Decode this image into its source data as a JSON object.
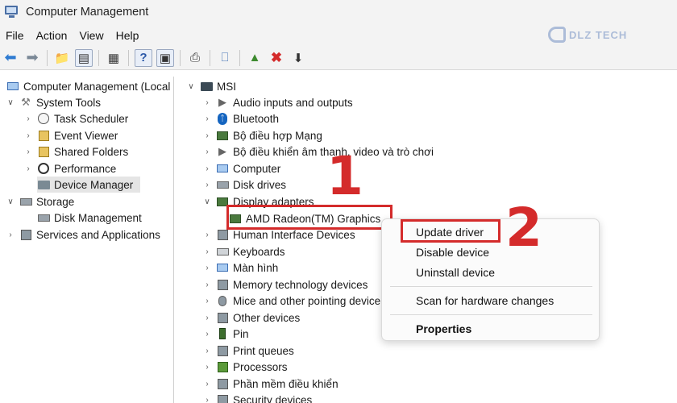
{
  "window": {
    "title": "Computer Management"
  },
  "watermark": {
    "text": "DLZ TECH"
  },
  "menubar": {
    "items": [
      "File",
      "Action",
      "View",
      "Help"
    ]
  },
  "left_tree": {
    "root": "Computer Management (Local",
    "system_tools": "System Tools",
    "task_scheduler": "Task Scheduler",
    "event_viewer": "Event Viewer",
    "shared_folders": "Shared Folders",
    "performance": "Performance",
    "device_manager": "Device Manager",
    "storage": "Storage",
    "disk_management": "Disk Management",
    "services_and_applications": "Services and Applications"
  },
  "device_tree": {
    "root": "MSI",
    "audio": "Audio inputs and outputs",
    "bluetooth": "Bluetooth",
    "network": "Bộ điều hợp Mạng",
    "sound": "Bộ điều khiển âm thanh, video và trò chơi",
    "computer": "Computer",
    "disk_drives": "Disk drives",
    "display_adapters": "Display adapters",
    "amd_graphics": "AMD Radeon(TM) Graphics",
    "hid": "Human Interface Devices",
    "keyboards": "Keyboards",
    "monitors": "Màn hình",
    "memory_tech": "Memory technology devices",
    "mice": "Mice and other pointing device",
    "other_devices": "Other devices",
    "pin": "Pin",
    "print_queues": "Print queues",
    "processors": "Processors",
    "software": "Phần mềm điều khiển",
    "security": "Security devices"
  },
  "context_menu": {
    "update_driver": "Update driver",
    "disable_device": "Disable device",
    "uninstall_device": "Uninstall device",
    "scan": "Scan for hardware changes",
    "properties": "Properties"
  },
  "annotations": {
    "step1": "1",
    "step2": "2",
    "color": "#d42b2b"
  }
}
